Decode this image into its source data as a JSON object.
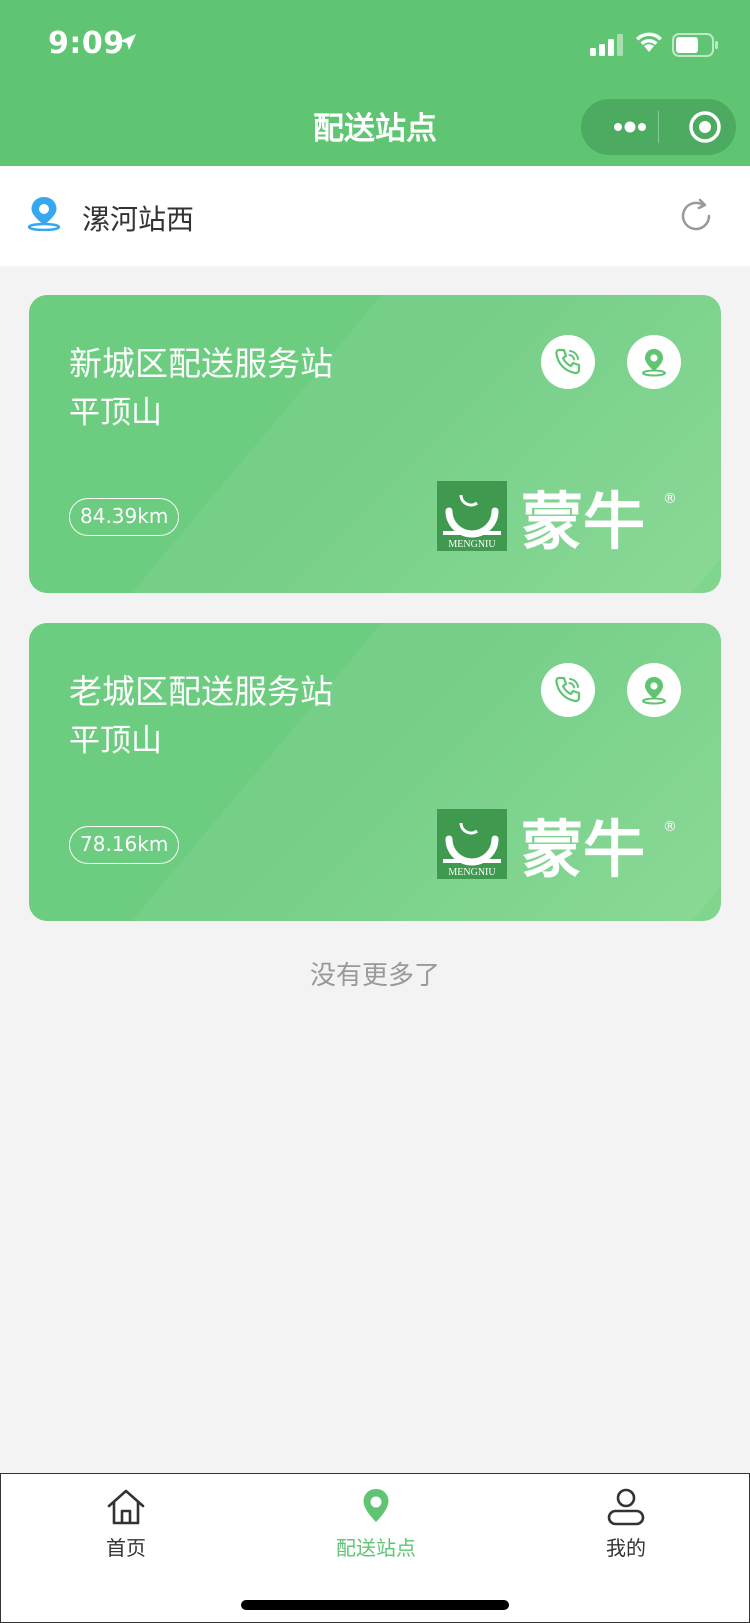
{
  "status": {
    "time": "9:09"
  },
  "nav": {
    "title": "配送站点"
  },
  "location": {
    "name": "漯河站西"
  },
  "stations": [
    {
      "name": "新城区配送服务站",
      "city": "平顶山",
      "distance": "84.39km"
    },
    {
      "name": "老城区配送服务站",
      "city": "平顶山",
      "distance": "78.16km"
    }
  ],
  "footer": {
    "no_more": "没有更多了"
  },
  "brand": {
    "logo_text": "蒙牛",
    "logo_sub": "MENGNIU",
    "registered": "®"
  },
  "tabbar": {
    "items": [
      {
        "label": "首页",
        "icon": "home-icon"
      },
      {
        "label": "配送站点",
        "icon": "location-pin-icon",
        "active": true
      },
      {
        "label": "我的",
        "icon": "user-icon"
      }
    ]
  },
  "colors": {
    "primary": "#5fc573",
    "card": "#6ccc80",
    "pin_blue": "#36a8f0"
  }
}
